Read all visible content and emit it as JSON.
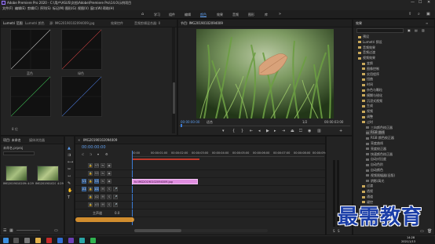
{
  "window": {
    "title": "Adobe Premiere Pro 2020 - C:\\用户\\ASUS\\文档\\Adobe\\Premiere Pro\\14.0\\示例项目",
    "controls": [
      "—",
      "☐",
      "✕"
    ]
  },
  "menu": [
    "文件(F)",
    "编辑(E)",
    "剪辑(C)",
    "序列(S)",
    "标记(M)",
    "图形(G)",
    "视图(V)",
    "窗口(W)",
    "帮助(H)"
  ],
  "workspaces": [
    {
      "label": "学习",
      "active": false
    },
    {
      "label": "组件",
      "active": false
    },
    {
      "label": "编辑",
      "active": false
    },
    {
      "label": "颜色",
      "active": true
    },
    {
      "label": "效果",
      "active": false
    },
    {
      "label": "音频",
      "active": false
    },
    {
      "label": "图形",
      "active": false
    },
    {
      "label": "库",
      "active": false
    }
  ],
  "lumetri": {
    "tabs": [
      "Lumetri 范围",
      "Lumetri 颜色",
      "源: IMG20190102094009.jpg",
      "效果控件",
      "音频剪辑混合器: 0"
    ],
    "scope_labels": [
      "亮度",
      "蓝色",
      "绿色",
      "红色"
    ],
    "bottom_label": "8 位"
  },
  "program": {
    "tab": "节目: IMG20190102094009",
    "timecode_left": "00:00:00:00",
    "fit": "适合",
    "ratio": "1/2",
    "timecode_right": "00:00:03:00"
  },
  "project": {
    "tabs": [
      "项目: 未命名",
      "媒体浏览器"
    ],
    "file": "未命名.prproj",
    "items": [
      {
        "name": "IMG20190102094009.jpg",
        "duration": "4:29"
      },
      {
        "name": "IMG20190102094009",
        "duration": "4:29"
      }
    ]
  },
  "timeline": {
    "tab": "IMG20190102094009",
    "timecode": "00:00:00:00",
    "ruler": [
      "00:00",
      "00:00:01:00",
      "00:00:02:00",
      "00:00:03:00",
      "00:00:04:00",
      "00:00:05:00",
      "00:00:06:00",
      "00:00:07:00",
      "00:00:08:00",
      "00:00:09:00"
    ],
    "tracks": [
      "V3",
      "V2",
      "V1",
      "A1",
      "A2",
      "A3"
    ],
    "clip_name": "fx IMG20190102094009.jpg",
    "master_label": "主声道",
    "master_value": "0.0"
  },
  "effects": {
    "tab": "效果",
    "tree": [
      "预设",
      "Lumetri 预设",
      "音频效果",
      "音频过渡",
      "视频效果",
      "变换",
      "图像控制",
      "实用程序",
      "扭曲",
      "时间",
      "杂色与颗粒",
      "模糊与锐化",
      "沉浸式视频",
      "生成",
      "视频",
      "调整",
      "过时",
      "三向颜色校正器",
      "RGB 曲线",
      "RGB 颜色校正器",
      "亮度曲线",
      "亮度校正器",
      "快速颜色校正器",
      "自动对比度",
      "自动色阶",
      "自动颜色",
      "视频限幅器(旧版)",
      "阴影/高光",
      "过渡",
      "透视",
      "通道",
      "键控",
      "颜色校正",
      "风格化",
      "视频过渡"
    ],
    "highlight_index": 18
  },
  "taskbar": {
    "time": "14:28",
    "date": "2021/1/13"
  },
  "watermark": "最需教育",
  "colors": {
    "accent": "#5d9cec",
    "clip": "#e08ee0",
    "playhead": "#3b7bd6",
    "watermark": "#1b3ea8"
  }
}
